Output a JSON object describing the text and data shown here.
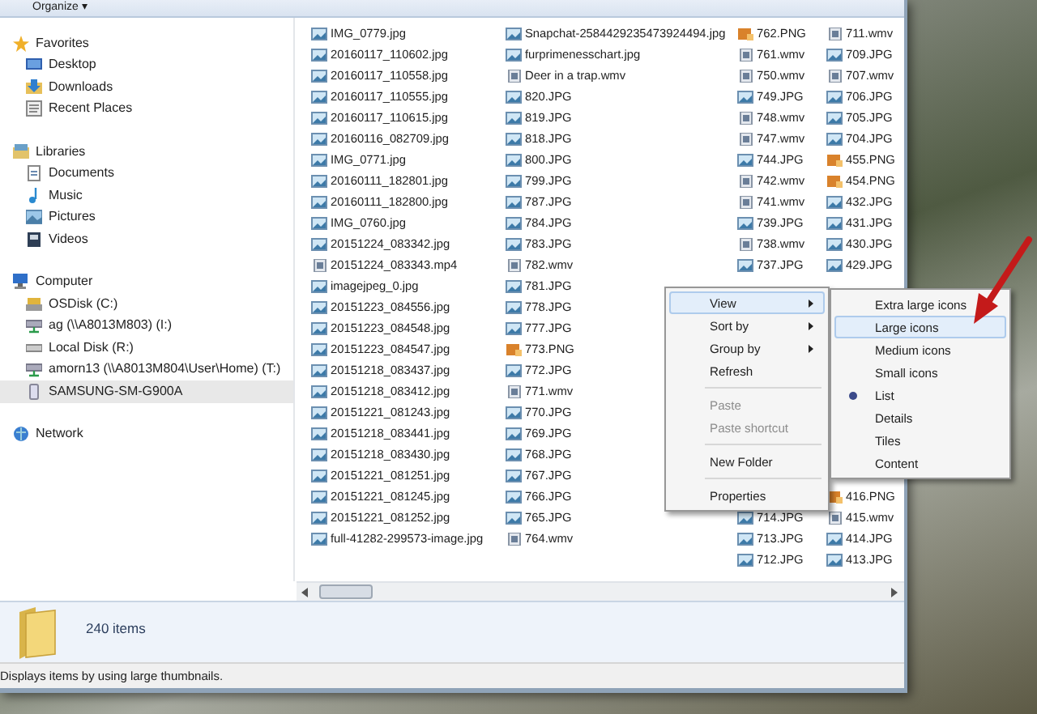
{
  "toolbar": {
    "organize": "Organize ▾"
  },
  "navigation": [
    {
      "label": "Favorites",
      "kind": "star",
      "selected": false,
      "children": [
        {
          "label": "Desktop",
          "kind": "desktop",
          "selected": false
        },
        {
          "label": "Downloads",
          "kind": "downloads",
          "selected": false
        },
        {
          "label": "Recent Places",
          "kind": "recent",
          "selected": false
        }
      ]
    },
    {
      "label": "Libraries",
      "kind": "libraries",
      "selected": false,
      "children": [
        {
          "label": "Documents",
          "kind": "document",
          "selected": false
        },
        {
          "label": "Music",
          "kind": "music",
          "selected": false
        },
        {
          "label": "Pictures",
          "kind": "pictures",
          "selected": false
        },
        {
          "label": "Videos",
          "kind": "videos",
          "selected": false
        }
      ]
    },
    {
      "label": "Computer",
      "kind": "computer",
      "selected": false,
      "children": [
        {
          "label": "OSDisk (C:)",
          "kind": "osdisk",
          "selected": false
        },
        {
          "label": "ag (\\\\A8013M803) (I:)",
          "kind": "netdrive",
          "selected": false
        },
        {
          "label": "Local Disk (R:)",
          "kind": "drive",
          "selected": false
        },
        {
          "label": "amorn13 (\\\\A8013M804\\User\\Home) (T:)",
          "kind": "netdrive",
          "selected": false
        },
        {
          "label": "SAMSUNG-SM-G900A",
          "kind": "phone",
          "selected": true
        }
      ]
    },
    {
      "label": "Network",
      "kind": "network",
      "selected": false
    }
  ],
  "file_columns": [
    {
      "items_top": [
        {
          "name": "IMG_0779.jpg",
          "kind": "image"
        },
        {
          "name": "20160117_110602.jpg",
          "kind": "image"
        },
        {
          "name": "20160117_110558.jpg",
          "kind": "image"
        },
        {
          "name": "20160117_110555.jpg",
          "kind": "image"
        },
        {
          "name": "20160117_110615.jpg",
          "kind": "image"
        },
        {
          "name": "20160116_082709.jpg",
          "kind": "image"
        },
        {
          "name": "IMG_0771.jpg",
          "kind": "image"
        },
        {
          "name": "20160111_182801.jpg",
          "kind": "image"
        },
        {
          "name": "20160111_182800.jpg",
          "kind": "image"
        },
        {
          "name": "IMG_0760.jpg",
          "kind": "image"
        },
        {
          "name": "20151224_083342.jpg",
          "kind": "image"
        },
        {
          "name": "20151224_083343.mp4",
          "kind": "video"
        },
        {
          "name": "imagejpeg_0.jpg",
          "kind": "image"
        },
        {
          "name": "20151223_084556.jpg",
          "kind": "image"
        },
        {
          "name": "20151223_084548.jpg",
          "kind": "image"
        },
        {
          "name": "20151223_084547.jpg",
          "kind": "image"
        },
        {
          "name": "20151218_083437.jpg",
          "kind": "image"
        },
        {
          "name": "20151218_083412.jpg",
          "kind": "image"
        },
        {
          "name": "20151221_081243.jpg",
          "kind": "image"
        },
        {
          "name": "20151218_083441.jpg",
          "kind": "image"
        },
        {
          "name": "20151218_083430.jpg",
          "kind": "image"
        },
        {
          "name": "20151221_081251.jpg",
          "kind": "image"
        },
        {
          "name": "20151221_081245.jpg",
          "kind": "image"
        },
        {
          "name": "20151221_081252.jpg",
          "kind": "image"
        },
        {
          "name": "full-41282-299573-image.jpg",
          "kind": "image"
        }
      ]
    },
    {
      "items_top": [
        {
          "name": "Snapchat-2584429235473924494.jpg",
          "kind": "image"
        },
        {
          "name": "furprimenesschart.jpg",
          "kind": "image"
        },
        {
          "name": "Deer in a trap.wmv",
          "kind": "video"
        },
        {
          "name": "820.JPG",
          "kind": "image"
        },
        {
          "name": "819.JPG",
          "kind": "image"
        },
        {
          "name": "818.JPG",
          "kind": "image"
        },
        {
          "name": "800.JPG",
          "kind": "image"
        },
        {
          "name": "799.JPG",
          "kind": "image"
        },
        {
          "name": "787.JPG",
          "kind": "image"
        },
        {
          "name": "784.JPG",
          "kind": "image"
        },
        {
          "name": "783.JPG",
          "kind": "image"
        },
        {
          "name": "782.wmv",
          "kind": "video"
        },
        {
          "name": "781.JPG",
          "kind": "image"
        },
        {
          "name": "778.JPG",
          "kind": "image"
        },
        {
          "name": "777.JPG",
          "kind": "image"
        },
        {
          "name": "773.PNG",
          "kind": "png"
        },
        {
          "name": "772.JPG",
          "kind": "image"
        },
        {
          "name": "771.wmv",
          "kind": "video"
        },
        {
          "name": "770.JPG",
          "kind": "image"
        },
        {
          "name": "769.JPG",
          "kind": "image"
        },
        {
          "name": "768.JPG",
          "kind": "image"
        },
        {
          "name": "767.JPG",
          "kind": "image"
        },
        {
          "name": "766.JPG",
          "kind": "image"
        },
        {
          "name": "765.JPG",
          "kind": "image"
        },
        {
          "name": "764.wmv",
          "kind": "video"
        }
      ]
    },
    {
      "items_top": [
        {
          "name": "762.PNG",
          "kind": "png"
        },
        {
          "name": "761.wmv",
          "kind": "video"
        },
        {
          "name": "750.wmv",
          "kind": "video"
        },
        {
          "name": "749.JPG",
          "kind": "image"
        },
        {
          "name": "748.wmv",
          "kind": "video"
        },
        {
          "name": "747.wmv",
          "kind": "video"
        },
        {
          "name": "744.JPG",
          "kind": "image"
        },
        {
          "name": "742.wmv",
          "kind": "video"
        },
        {
          "name": "741.wmv",
          "kind": "video"
        },
        {
          "name": "739.JPG",
          "kind": "image"
        },
        {
          "name": "738.wmv",
          "kind": "video"
        },
        {
          "name": "737.JPG",
          "kind": "image"
        }
      ],
      "items_bottom": [
        {
          "name": "714.JPG",
          "kind": "image"
        },
        {
          "name": "713.JPG",
          "kind": "image"
        },
        {
          "name": "712.JPG",
          "kind": "image"
        }
      ]
    },
    {
      "items_top": [
        {
          "name": "711.wmv",
          "kind": "video"
        },
        {
          "name": "709.JPG",
          "kind": "image"
        },
        {
          "name": "707.wmv",
          "kind": "video"
        },
        {
          "name": "706.JPG",
          "kind": "image"
        },
        {
          "name": "705.JPG",
          "kind": "image"
        },
        {
          "name": "704.JPG",
          "kind": "image"
        },
        {
          "name": "455.PNG",
          "kind": "png"
        },
        {
          "name": "454.PNG",
          "kind": "png"
        },
        {
          "name": "432.JPG",
          "kind": "image"
        },
        {
          "name": "431.JPG",
          "kind": "image"
        },
        {
          "name": "430.JPG",
          "kind": "image"
        },
        {
          "name": "429.JPG",
          "kind": "image"
        }
      ],
      "items_bottom": [
        {
          "name": "416.PNG",
          "kind": "png"
        },
        {
          "name": "415.wmv",
          "kind": "video"
        },
        {
          "name": "414.JPG",
          "kind": "image"
        },
        {
          "name": "413.JPG",
          "kind": "image"
        }
      ]
    }
  ],
  "details_pane": {
    "count": "240 items"
  },
  "status_bar": {
    "text": "Displays items by using large thumbnails."
  },
  "context_menu": [
    {
      "kind": "item",
      "label": "View",
      "submenu": true,
      "highlighted": true,
      "disabled": false
    },
    {
      "kind": "item",
      "label": "Sort by",
      "submenu": true,
      "highlighted": false,
      "disabled": false
    },
    {
      "kind": "item",
      "label": "Group by",
      "submenu": true,
      "highlighted": false,
      "disabled": false
    },
    {
      "kind": "item",
      "label": "Refresh",
      "submenu": false,
      "highlighted": false,
      "disabled": false
    },
    {
      "kind": "separator"
    },
    {
      "kind": "item",
      "label": "Paste",
      "submenu": false,
      "highlighted": false,
      "disabled": true
    },
    {
      "kind": "item",
      "label": "Paste shortcut",
      "submenu": false,
      "highlighted": false,
      "disabled": true
    },
    {
      "kind": "separator"
    },
    {
      "kind": "item",
      "label": "New Folder",
      "submenu": false,
      "highlighted": false,
      "disabled": false
    },
    {
      "kind": "separator"
    },
    {
      "kind": "item",
      "label": "Properties",
      "submenu": false,
      "highlighted": false,
      "disabled": false
    }
  ],
  "view_submenu": [
    {
      "label": "Extra large icons",
      "selected": false,
      "highlighted": false
    },
    {
      "label": "Large icons",
      "selected": false,
      "highlighted": true
    },
    {
      "label": "Medium icons",
      "selected": false,
      "highlighted": false
    },
    {
      "label": "Small icons",
      "selected": false,
      "highlighted": false
    },
    {
      "label": "List",
      "selected": true,
      "highlighted": false
    },
    {
      "label": "Details",
      "selected": false,
      "highlighted": false
    },
    {
      "label": "Tiles",
      "selected": false,
      "highlighted": false
    },
    {
      "label": "Content",
      "selected": false,
      "highlighted": false
    }
  ]
}
